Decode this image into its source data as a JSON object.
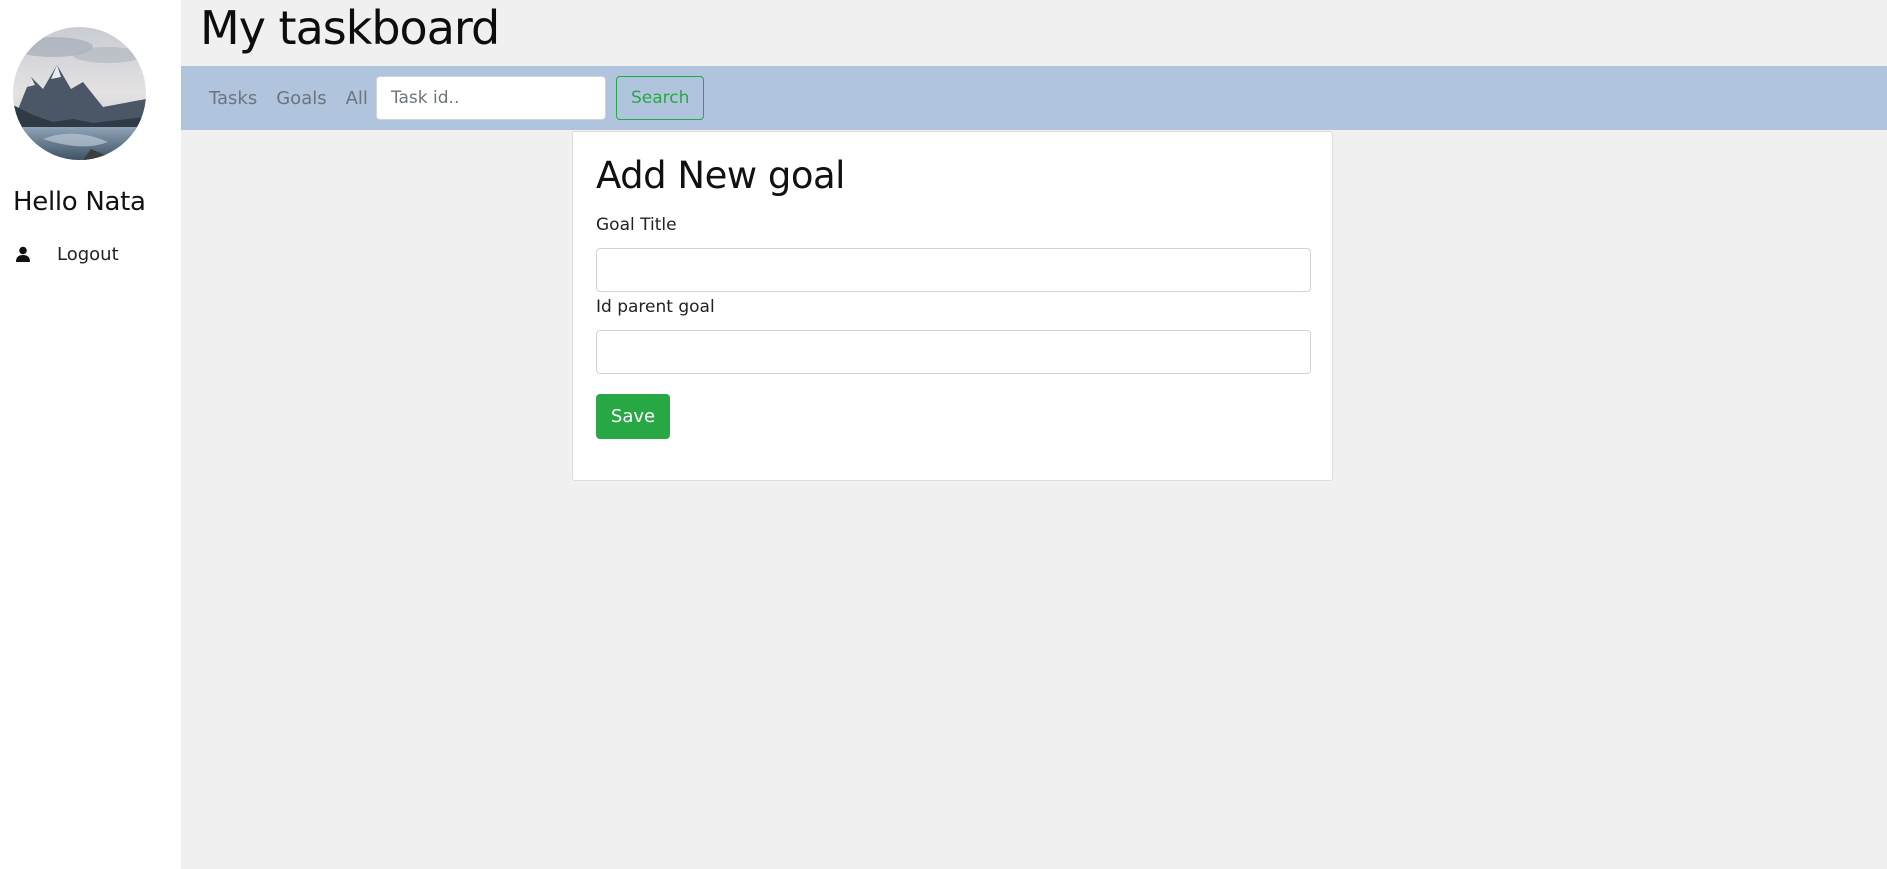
{
  "sidebar": {
    "avatar": {
      "icon": "mountain-lake-photo"
    },
    "greeting": "Hello Nata",
    "logout": {
      "icon": "user-icon",
      "label": "Logout"
    }
  },
  "header": {
    "title": "My taskboard"
  },
  "navbar": {
    "background": "#b0c4de",
    "links": [
      "Tasks",
      "Goals",
      "All"
    ],
    "search": {
      "placeholder": "Task id..",
      "value": "",
      "button_label": "Search"
    }
  },
  "form": {
    "title": "Add New goal",
    "fields": [
      {
        "label": "Goal Title",
        "value": ""
      },
      {
        "label": "Id parent goal",
        "value": ""
      }
    ],
    "save_label": "Save"
  },
  "colors": {
    "accent_green": "#28a745",
    "nav_bg": "#b0c4de",
    "page_bg": "#f0f0f0"
  }
}
